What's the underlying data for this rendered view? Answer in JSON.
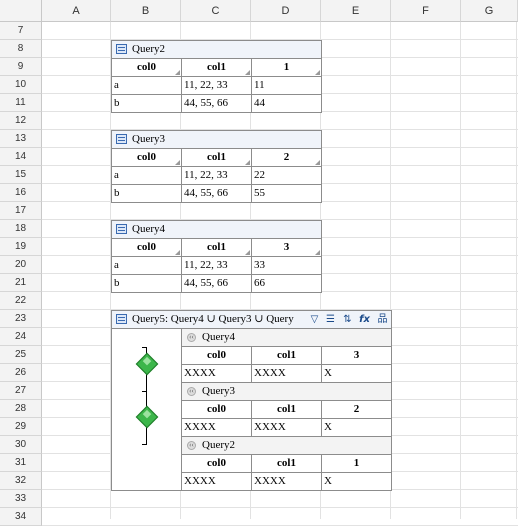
{
  "columns": [
    "A",
    "B",
    "C",
    "D",
    "E",
    "F",
    "G"
  ],
  "rows": [
    "7",
    "8",
    "9",
    "10",
    "11",
    "12",
    "13",
    "14",
    "15",
    "16",
    "17",
    "18",
    "19",
    "20",
    "21",
    "22",
    "23",
    "24",
    "25",
    "26",
    "27",
    "28",
    "29",
    "30",
    "31",
    "32",
    "33",
    "34"
  ],
  "queries": [
    {
      "title": "Query2",
      "headers": [
        "col0",
        "col1",
        "1"
      ],
      "rows": [
        [
          "a",
          "11, 22, 33",
          "11"
        ],
        [
          "b",
          "44, 55, 66",
          "44"
        ]
      ]
    },
    {
      "title": "Query3",
      "headers": [
        "col0",
        "col1",
        "2"
      ],
      "rows": [
        [
          "a",
          "11, 22, 33",
          "22"
        ],
        [
          "b",
          "44, 55, 66",
          "55"
        ]
      ]
    },
    {
      "title": "Query4",
      "headers": [
        "col0",
        "col1",
        "3"
      ],
      "rows": [
        [
          "a",
          "11, 22, 33",
          "33"
        ],
        [
          "b",
          "44, 55, 66",
          "66"
        ]
      ]
    }
  ],
  "union": {
    "title": "Query5:  Query4 ∪ Query3 ∪ Query",
    "tools": [
      "filter-icon",
      "list-icon",
      "sort-icon",
      "function-icon",
      "tree-icon"
    ],
    "tool_glyphs": [
      "▽",
      "☰",
      "⇅",
      "fx",
      "品"
    ],
    "subs": [
      {
        "title": "Query4",
        "headers": [
          "col0",
          "col1",
          "3"
        ],
        "row": [
          "XXXX",
          "XXXX",
          "X"
        ]
      },
      {
        "title": "Query3",
        "headers": [
          "col0",
          "col1",
          "2"
        ],
        "row": [
          "XXXX",
          "XXXX",
          "X"
        ]
      },
      {
        "title": "Query2",
        "headers": [
          "col0",
          "col1",
          "1"
        ],
        "row": [
          "XXXX",
          "XXXX",
          "X"
        ]
      }
    ],
    "chevron": "‹‹"
  }
}
